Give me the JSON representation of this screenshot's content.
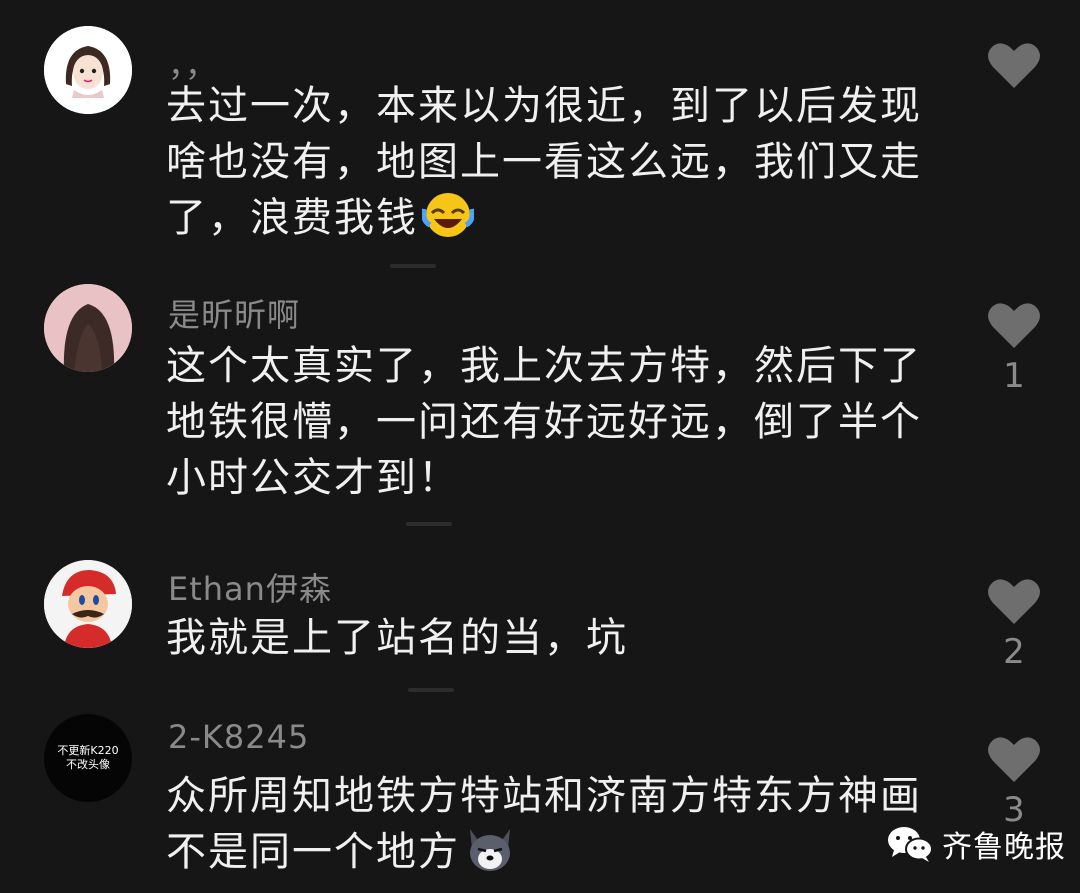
{
  "comments": [
    {
      "username": "，，",
      "lines": [
        "去过一次，本来以为很近，到了以后发现",
        "啥也没有，地图上一看这么远，我们又走",
        "了，浪费我钱"
      ],
      "emoji": "laughing-crying-emoji",
      "likes": ""
    },
    {
      "username": "是昕昕啊",
      "lines": [
        "这个太真实了，我上次去方特，然后下了",
        "地铁很懵，一问还有好远好远，倒了半个",
        "小时公交才到！"
      ],
      "likes": "1"
    },
    {
      "username": "Ethan伊森",
      "lines": [
        "我就是上了站名的当，坑"
      ],
      "likes": "2"
    },
    {
      "username": "2-K8245",
      "avatar_text": [
        "不更新K220",
        "不改头像"
      ],
      "lines": [
        "众所周知地铁方特站和济南方特东方神画",
        "不是同一个地方"
      ],
      "emoji": "husky-emoji",
      "likes": "3"
    }
  ],
  "watermark": {
    "text": "齐鲁晚报",
    "icon": "wechat-icon"
  },
  "colors": {
    "background": "#161616",
    "text": "#f0f0f0",
    "muted": "#8a8a8a",
    "heart": "#6e6e6e"
  }
}
